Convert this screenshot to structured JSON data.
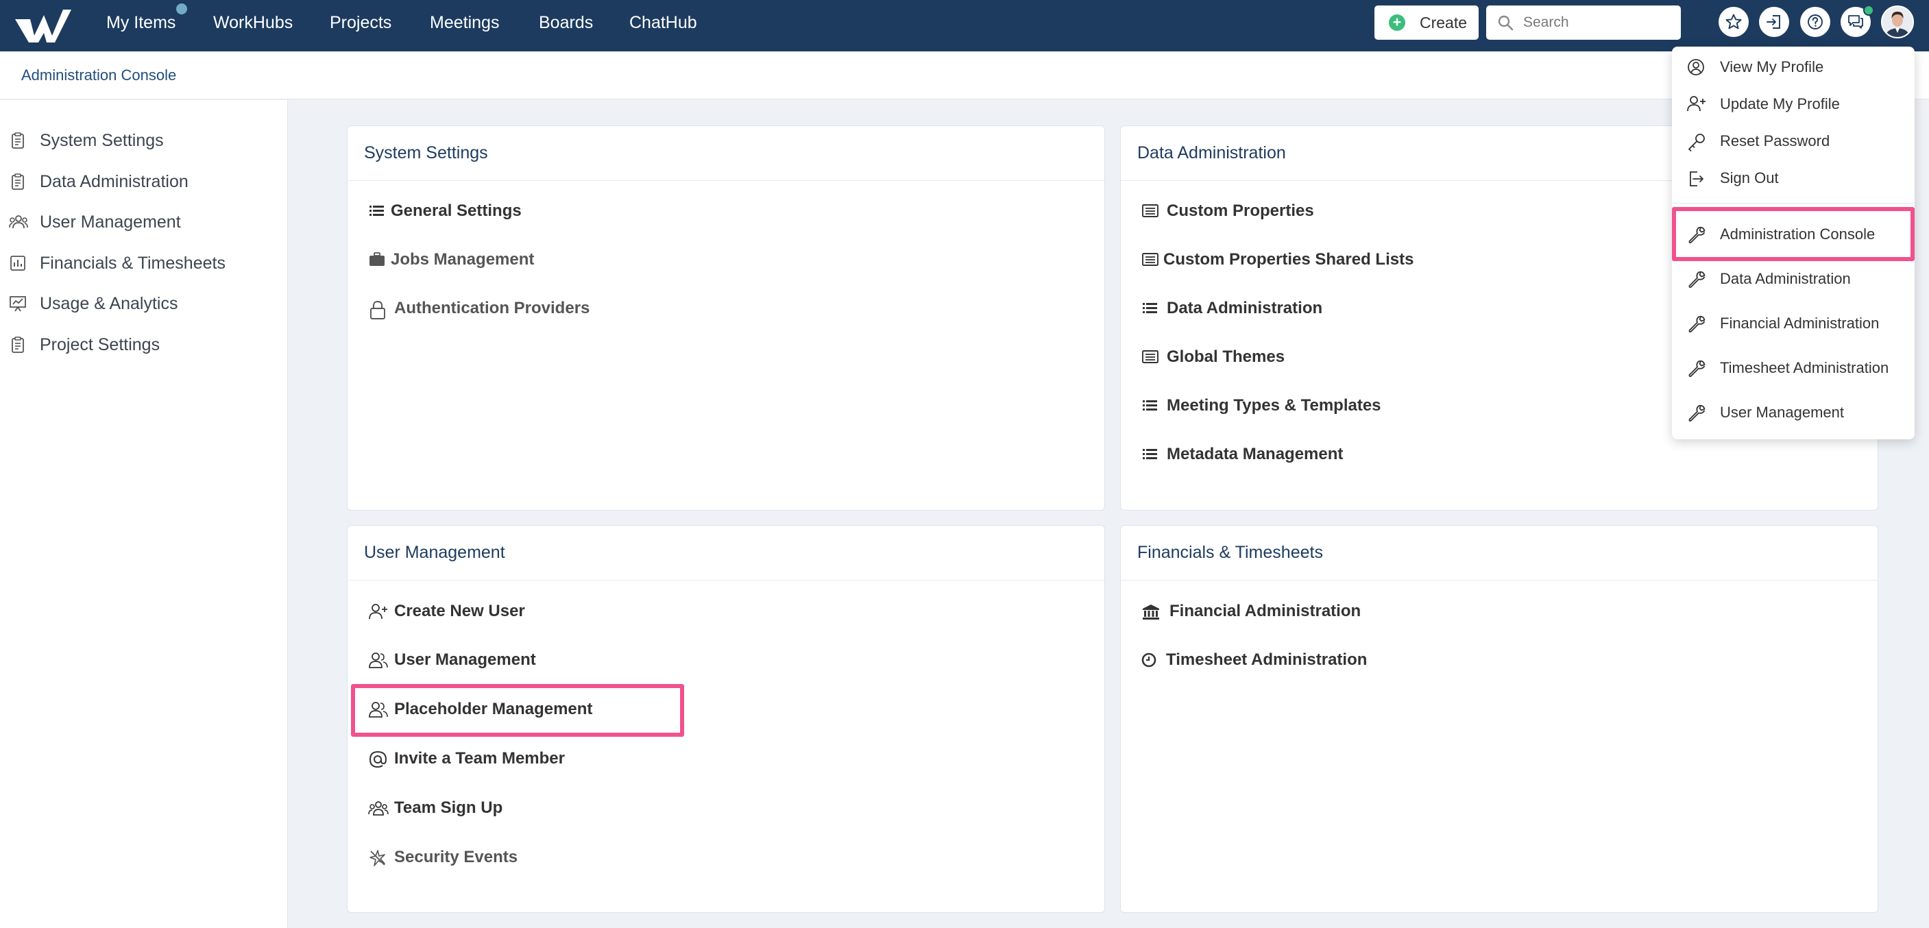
{
  "top_nav": {
    "items": [
      {
        "label": "My Items"
      },
      {
        "label": "WorkHubs"
      },
      {
        "label": "Projects"
      },
      {
        "label": "Meetings"
      },
      {
        "label": "Boards"
      },
      {
        "label": "ChatHub"
      }
    ],
    "create_label": "Create",
    "search_placeholder": "Search"
  },
  "breadcrumb": {
    "label": "Administration Console"
  },
  "sidebar": {
    "items": [
      {
        "label": "System Settings",
        "icon": "clipboard-icon"
      },
      {
        "label": "Data Administration",
        "icon": "clipboard-icon"
      },
      {
        "label": "User Management",
        "icon": "users-icon"
      },
      {
        "label": "Financials & Timesheets",
        "icon": "bar-chart-icon"
      },
      {
        "label": "Usage & Analytics",
        "icon": "presentation-chart-icon"
      },
      {
        "label": "Project Settings",
        "icon": "clipboard-icon"
      }
    ]
  },
  "cards": {
    "system_settings": {
      "title": "System Settings",
      "links": [
        {
          "label": "General Settings",
          "icon": "list-icon"
        },
        {
          "label": "Jobs Management",
          "icon": "briefcase-icon"
        },
        {
          "label": "Authentication Providers",
          "icon": "lock-icon"
        }
      ]
    },
    "data_administration": {
      "title": "Data Administration",
      "links": [
        {
          "label": "Custom Properties",
          "icon": "list-box-icon"
        },
        {
          "label": "Custom Properties Shared Lists",
          "icon": "list-box-icon"
        },
        {
          "label": "Data Administration",
          "icon": "list-icon"
        },
        {
          "label": "Global Themes",
          "icon": "list-box-icon"
        },
        {
          "label": "Meeting Types & Templates",
          "icon": "list-icon"
        },
        {
          "label": "Metadata Management",
          "icon": "list-icon"
        }
      ]
    },
    "user_management": {
      "title": "User Management",
      "links": [
        {
          "label": "Create New User",
          "icon": "user-plus-icon"
        },
        {
          "label": "User Management",
          "icon": "users-icon"
        },
        {
          "label": "Placeholder Management",
          "icon": "users-icon"
        },
        {
          "label": "Invite a Team Member",
          "icon": "at-sign-icon"
        },
        {
          "label": "Team Sign Up",
          "icon": "team-icon"
        },
        {
          "label": "Security Events",
          "icon": "security-events-icon"
        }
      ]
    },
    "financials": {
      "title": "Financials & Timesheets",
      "links": [
        {
          "label": "Financial Administration",
          "icon": "bank-icon"
        },
        {
          "label": "Timesheet Administration",
          "icon": "clock-icon"
        }
      ]
    }
  },
  "user_menu": {
    "items": [
      {
        "label": "View My Profile",
        "icon": "user-circle-icon"
      },
      {
        "label": "Update My Profile",
        "icon": "user-plus-icon"
      },
      {
        "label": "Reset Password",
        "icon": "key-icon"
      },
      {
        "label": "Sign Out",
        "icon": "sign-out-icon"
      },
      {
        "label": "Administration Console",
        "icon": "wrench-icon"
      },
      {
        "label": "Data Administration",
        "icon": "wrench-icon"
      },
      {
        "label": "Financial Administration",
        "icon": "wrench-icon"
      },
      {
        "label": "Timesheet Administration",
        "icon": "wrench-icon"
      },
      {
        "label": "User Management",
        "icon": "wrench-icon"
      }
    ]
  },
  "colors": {
    "topbar": "#1c3b5f",
    "highlight": "#f0528e",
    "create_plus": "#3dbd7d",
    "notification_dot": "#72aac8"
  }
}
